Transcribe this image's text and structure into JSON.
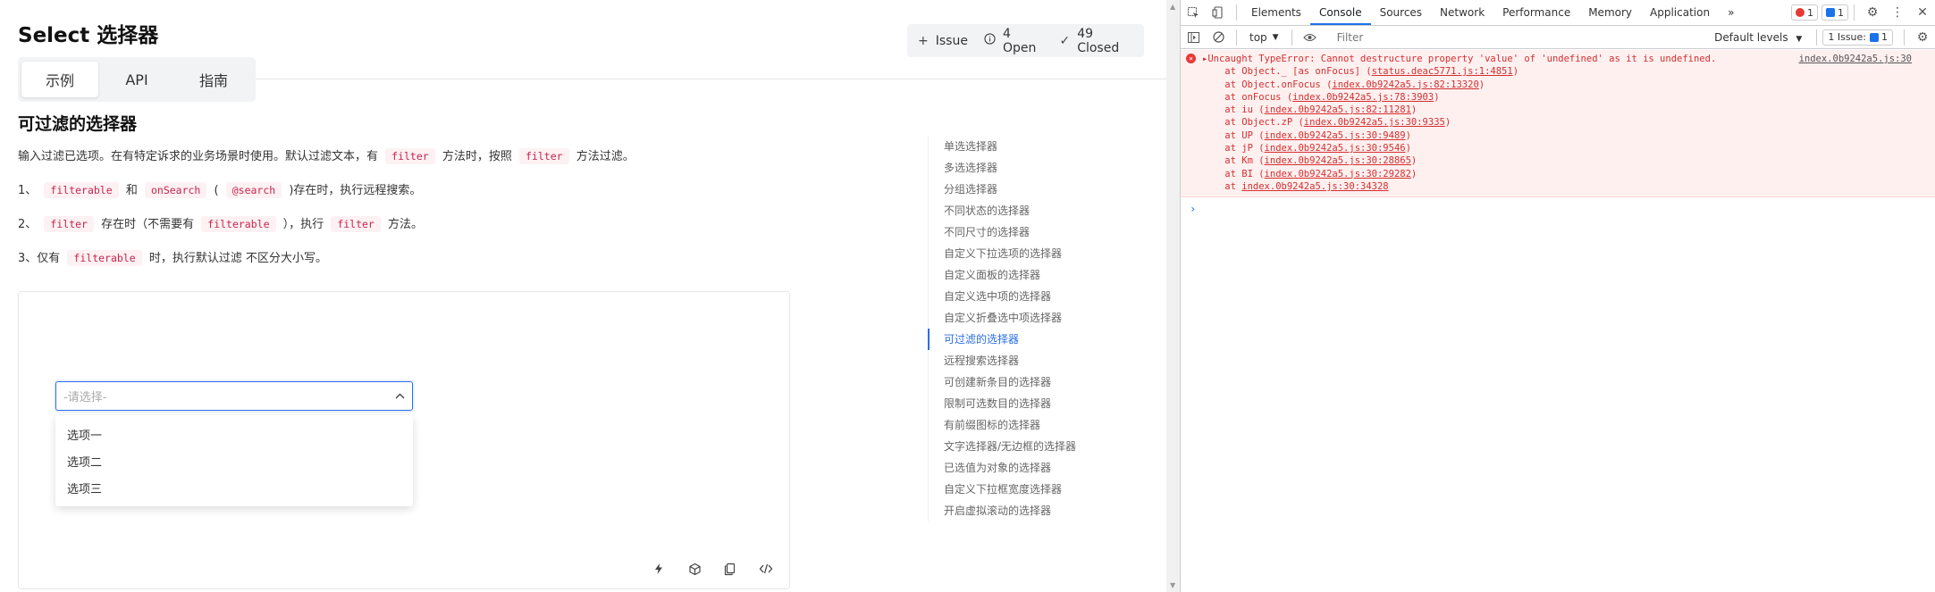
{
  "page": {
    "title": "Select 选择器",
    "issue_bar": {
      "issue": "Issue",
      "open": "4 Open",
      "closed": "49 Closed"
    },
    "tabs": [
      "示例",
      "API",
      "指南"
    ],
    "section_title": "可过滤的选择器",
    "intro": {
      "p1": "输入过滤已选项。在有特定诉求的业务场景时使用。默认过滤文本，有",
      "code1": "filter",
      "p2": "方法时，按照",
      "code2": "filter",
      "p3": "方法过滤。"
    },
    "item1": {
      "p0": "1、",
      "code1": "filterable",
      "p1": "和",
      "code2": "onSearch",
      "p2": "(",
      "code3": "@search",
      "p3": ")存在时，执行远程搜索。"
    },
    "item2": {
      "p0": "2、",
      "code1": "filter",
      "p1": "存在时（不需要有",
      "code2": "filterable",
      "p2": "），执行",
      "code3": "filter",
      "p3": "方法。"
    },
    "item3": {
      "p0": "3、仅有",
      "code1": "filterable",
      "p1": "时，执行默认过滤 不区分大小写。"
    },
    "demo": {
      "placeholder": "-请选择-",
      "options": [
        "选项一",
        "选项二",
        "选项三"
      ]
    },
    "toc": [
      "单选选择器",
      "多选选择器",
      "分组选择器",
      "不同状态的选择器",
      "不同尺寸的选择器",
      "自定义下拉选项的选择器",
      "自定义面板的选择器",
      "自定义选中项的选择器",
      "自定义折叠选中项选择器",
      "可过滤的选择器",
      "远程搜索选择器",
      "可创建新条目的选择器",
      "限制可选数目的选择器",
      "有前缀图标的选择器",
      "文字选择器/无边框的选择器",
      "已选值为对象的选择器",
      "自定义下拉框宽度选择器",
      "开启虚拟滚动的选择器"
    ],
    "toc_active_index": 9
  },
  "devtools": {
    "tabs": [
      "Elements",
      "Console",
      "Sources",
      "Network",
      "Performance",
      "Memory",
      "Application"
    ],
    "active_tab": "Console",
    "more": "»",
    "error_count": "1",
    "message_count": "1",
    "context": "top",
    "filter_placeholder": "Filter",
    "levels": "Default levels",
    "issues_label": "1 Issue:",
    "issues_count": "1",
    "error": {
      "message": "Uncaught TypeError: Cannot destructure property 'value' of 'undefined' as it is undefined.",
      "source": "index.0b9242a5.js:30",
      "stack": [
        {
          "pre": "    at Object._ [as onFocus] (",
          "link": "status.deac5771.js:1:4851",
          "post": ")"
        },
        {
          "pre": "    at Object.onFocus (",
          "link": "index.0b9242a5.js:82:13320",
          "post": ")"
        },
        {
          "pre": "    at onFocus (",
          "link": "index.0b9242a5.js:78:3903",
          "post": ")"
        },
        {
          "pre": "    at iu (",
          "link": "index.0b9242a5.js:82:11281",
          "post": ")"
        },
        {
          "pre": "    at Object.zP (",
          "link": "index.0b9242a5.js:30:9335",
          "post": ")"
        },
        {
          "pre": "    at UP (",
          "link": "index.0b9242a5.js:30:9489",
          "post": ")"
        },
        {
          "pre": "    at jP (",
          "link": "index.0b9242a5.js:30:9546",
          "post": ")"
        },
        {
          "pre": "    at Km (",
          "link": "index.0b9242a5.js:30:28865",
          "post": ")"
        },
        {
          "pre": "    at BI (",
          "link": "index.0b9242a5.js:30:29282",
          "post": ")"
        },
        {
          "pre": "    at ",
          "link": "index.0b9242a5.js:30:34328",
          "post": ""
        }
      ]
    },
    "prompt": "›"
  }
}
